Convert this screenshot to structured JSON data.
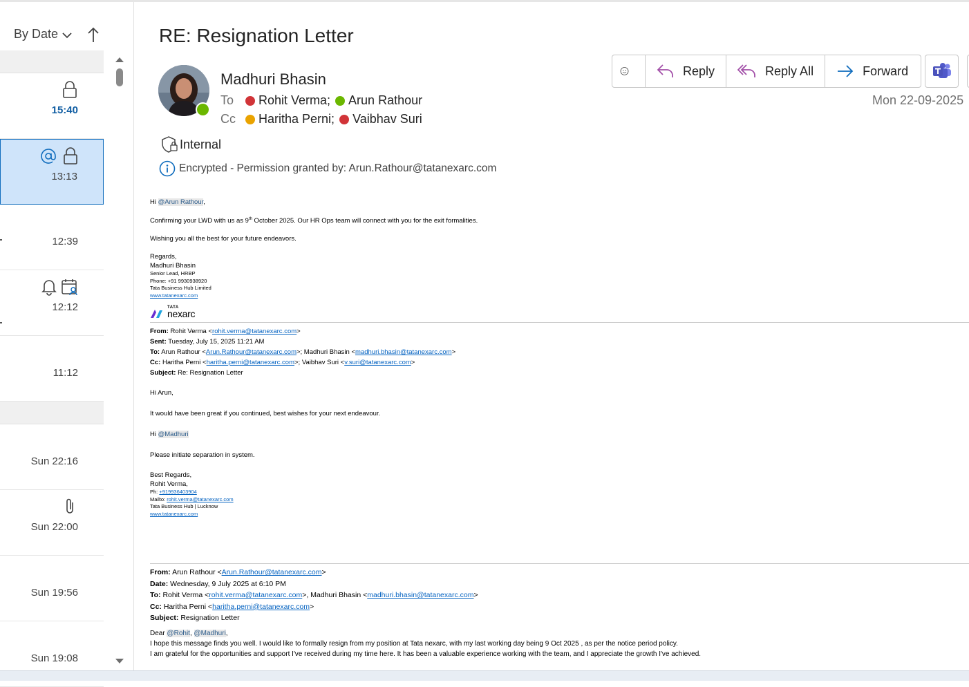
{
  "list": {
    "sort_label": "By Date",
    "rows": [
      {
        "time": "15:40"
      },
      {
        "time": "13:13"
      },
      {
        "time": "12:39"
      },
      {
        "time": "12:12"
      },
      {
        "time": "11:12"
      },
      {
        "time": "Sun 22:16"
      },
      {
        "time": "Sun 22:00"
      },
      {
        "time": "Sun 19:56"
      },
      {
        "time": "Sun 19:08"
      }
    ]
  },
  "email": {
    "subject": "RE: Resignation Letter",
    "sender": "Madhuri Bhasin",
    "to_label": "To",
    "cc_label": "Cc",
    "to": [
      {
        "name": "Rohit Verma;",
        "status": "busy"
      },
      {
        "name": "Arun Rathour",
        "status": "available"
      }
    ],
    "cc": [
      {
        "name": "Haritha Perni;",
        "status": "away"
      },
      {
        "name": "Vaibhav Suri",
        "status": "busy"
      }
    ],
    "sensitivity": "Internal",
    "encryption": "Encrypted - Permission granted by: Arun.Rathour@tatanexarc.com",
    "date": "Mon 22-09-2025"
  },
  "actions": {
    "reply": "Reply",
    "reply_all": "Reply All",
    "forward": "Forward"
  },
  "body": {
    "greeting_prefix": "Hi ",
    "greeting_mention": "@Arun Rathour",
    "greeting_suffix": ",",
    "p1_before": "Confirming your LWD with us as 9",
    "p1_sup": "th",
    "p1_after": " October 2025. Our HR Ops team will connect with you for the exit formalities.",
    "p2": "Wishing you all the best for your future endeavors.",
    "regards": "Regards,",
    "sig_name": "Madhuri Bhasin",
    "sig_title": "Senior Lead, HRBP",
    "sig_phone": "Phone: +91 9930938920",
    "sig_company": "Tata Business Hub Limited",
    "sig_web": "www.tatanexarc.com",
    "logo_top": "TATA",
    "logo_bottom": "nexarc",
    "q1": {
      "from_label": "From:",
      "from_name": " Rohit Verma <",
      "from_email": "rohit.verma@tatanexarc.com",
      "sent_label": "Sent:",
      "sent": " Tuesday, July 15, 2025 11:21 AM",
      "to_label": "To:",
      "to_name1": " Arun Rathour <",
      "to_email1": "Arun.Rathour@tatanexarc.com",
      "to_name2": ">; Madhuri Bhasin <",
      "to_email2": "madhuri.bhasin@tatanexarc.com",
      "cc_label": "Cc:",
      "cc_name1": " Haritha Perni <",
      "cc_email1": "haritha.perni@tatanexarc.com",
      "cc_name2": ">; Vaibhav Suri <",
      "cc_email2": "v.suri@tatanexarc.com",
      "subject_label": "Subject:",
      "subject": " Re: Resignation Letter",
      "greeting": "Hi Arun,",
      "p1": "It would have been great if you continued, best wishes for your next endeavour.",
      "hi": "Hi ",
      "mention": "@Madhuri",
      "p2": "Please initiate separation in system.",
      "best": "Best Regards,",
      "name": "Rohit Verma,",
      "ph_label": "Ph: ",
      "ph": "+919936403904",
      "mail_label": "Mailto: ",
      "mail": "rohit.verma@tatanexarc.com",
      "company": "Tata Business Hub | Lucknow",
      "web": "www.tatanexarc.com"
    },
    "q2": {
      "from_label": "From:",
      "from_name": " Arun Rathour <",
      "from_email": "Arun.Rathour@tatanexarc.com",
      "date_label": "Date:",
      "date": " Wednesday, 9 July 2025 at 6:10 PM",
      "to_label": "To:",
      "to_name1": " Rohit Verma <",
      "to_email1": "rohit.verma@tatanexarc.com",
      "to_name2": ">, Madhuri Bhasin <",
      "to_email2": "madhuri.bhasin@tatanexarc.com",
      "cc_label": "Cc:",
      "cc_name": " Haritha Perni <",
      "cc_email": "haritha.perni@tatanexarc.com",
      "subject_label": "Subject:",
      "subject": " Resignation Letter",
      "dear": "Dear ",
      "mention1": "@Rohit",
      "mention2": "@Madhuri",
      "line1": "I hope this message finds you well. I would like to formally resign from my position at Tata nexarc, with my last working day being 9 Oct 2025 , as per the notice period policy.",
      "line2": "I am grateful for the opportunities and support I've received during my time here. It has been a valuable experience working with the team, and I appreciate the growth I've achieved."
    }
  }
}
